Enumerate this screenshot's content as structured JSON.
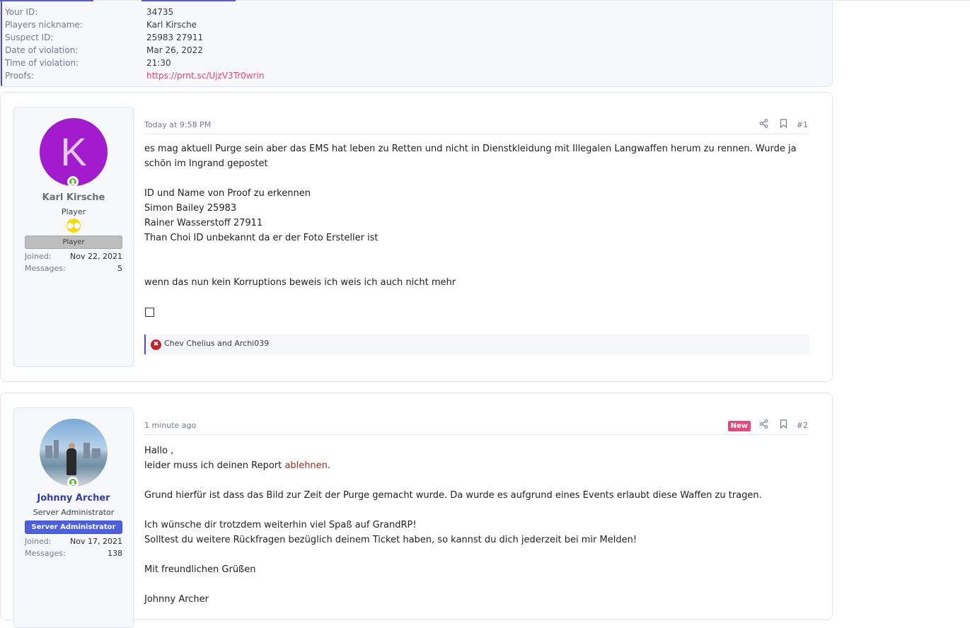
{
  "info": [
    {
      "key": "Your ID:",
      "value": "34735"
    },
    {
      "key": "Players nickname:",
      "value": "Karl Kirsche"
    },
    {
      "key": "Suspect ID:",
      "value": "25983 27911"
    },
    {
      "key": "Date of violation:",
      "value": "Mar 26, 2022"
    },
    {
      "key": "Time of violation:",
      "value": "21:30"
    },
    {
      "key": "Proofs:",
      "value": "https://prnt.sc/UjzV3Tr0wrin"
    }
  ],
  "posts": [
    {
      "user": {
        "avatar_letter": "K",
        "avatar_color": "#a21cce",
        "name": "Karl Kirsche",
        "title": "Player",
        "banner": "Player",
        "joined_label": "Joined:",
        "joined": "Nov 22, 2021",
        "messages_label": "Messages:",
        "messages": "5"
      },
      "date": "Today at 9:58 PM",
      "number": "#1",
      "lines": [
        "es mag aktuell Purge sein aber das EMS hat leben zu Retten und nicht in Dienstkleidung mit Illegalen Langwaffen herum zu rennen. Wurde ja",
        "schön im Ingrand gepostet",
        "ID und Name von Proof zu erkennen",
        "Simon Bailey 25983",
        "Rainer Wasserstoff 27911",
        "Than Choi ID unbekannt da er der Foto Ersteller ist",
        "wenn das nun kein Korruptions beweis ich weis ich auch nicht mehr"
      ],
      "reactions": "Chev Chelius and Archi039"
    },
    {
      "user": {
        "name": "Johnny Archer",
        "title": "Server Administrator",
        "banner": "Server Administrator",
        "joined_label": "Joined:",
        "joined": "Nov 17, 2021",
        "messages_label": "Messages:",
        "messages": "138"
      },
      "date": "1 minute ago",
      "new_label": "New",
      "number": "#2",
      "lines": [
        "Hallo ,",
        "leider muss ich deinen Report ",
        "ablehnen",
        ".",
        "Grund hierfür ist dass das Bild zur Zeit der Purge gemacht wurde. Da wurde es aufgrund eines Events erlaubt diese Waffen zu tragen.",
        "Ich wünsche dir trotzdem weiterhin viel Spaß auf GrandRP!",
        "Solltest du weitere Rückfragen bezüglich deinem Ticket haben, so kannst du dich jederzeit bei mir Melden!",
        "Mit freundlichen Grüßen",
        "Johnny Archer"
      ]
    }
  ],
  "colors": {
    "accent": "#4b4fb5",
    "link": "#e0457b",
    "new_badge": "#e24a7d",
    "admin_banner": "#4f5fd9",
    "online": "#63b342"
  },
  "icons": [
    "share-icon",
    "bookmark-icon",
    "online-icon",
    "group-badge-icon",
    "reaction-icon"
  ]
}
